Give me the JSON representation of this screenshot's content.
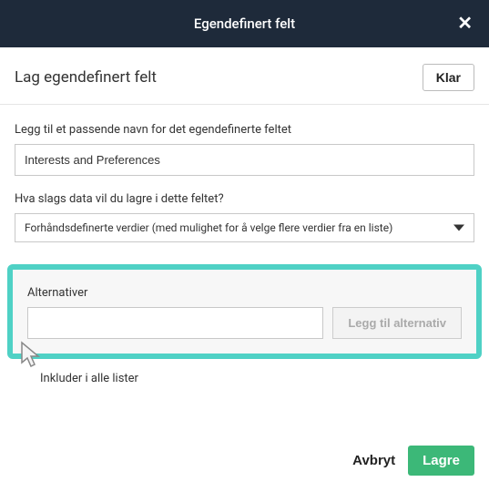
{
  "modal": {
    "title": "Egendefinert felt"
  },
  "section": {
    "title": "Lag egendefinert felt",
    "klar_label": "Klar"
  },
  "fields": {
    "name_label": "Legg til et passende navn for det egendefinerte feltet",
    "name_value": "Interests and Preferences",
    "type_label": "Hva slags data vil du lagre i dette feltet?",
    "type_value": "Forhåndsdefinerte verdier (med mulighet for å velge flere verdier fra en liste)"
  },
  "alternatives": {
    "label": "Alternativer",
    "input_value": "",
    "add_button": "Legg til alternativ"
  },
  "checkbox": {
    "label": "Inkluder i alle lister"
  },
  "footer": {
    "cancel": "Avbryt",
    "save": "Lagre"
  }
}
